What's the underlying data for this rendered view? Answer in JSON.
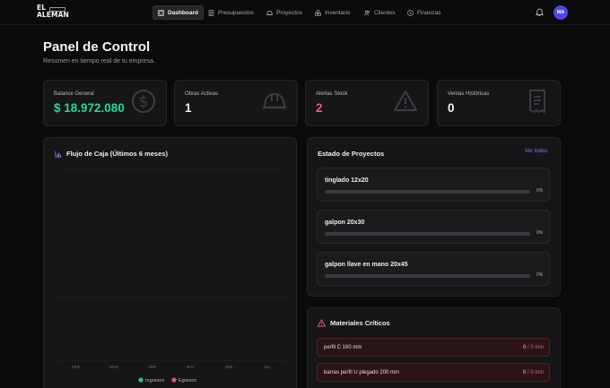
{
  "brand": {
    "line1": "EL",
    "line2": "ALEMAN"
  },
  "nav": {
    "items": [
      {
        "label": "Dashboard",
        "icon": "dashboard-icon",
        "active": true
      },
      {
        "label": "Presupuestos",
        "icon": "document-icon",
        "active": false
      },
      {
        "label": "Proyectos",
        "icon": "helmet-icon",
        "active": false
      },
      {
        "label": "Inventario",
        "icon": "boxes-icon",
        "active": false
      },
      {
        "label": "Clientes",
        "icon": "users-icon",
        "active": false
      },
      {
        "label": "Finanzas",
        "icon": "coin-icon",
        "active": false
      }
    ],
    "avatar": "MA"
  },
  "header": {
    "title": "Panel de Control",
    "subtitle": "Resumen en tiempo real de tu empresa."
  },
  "stats": [
    {
      "label": "Balance General",
      "value": "$ 18.972.080",
      "color": "#2fd19a",
      "icon": "dollar-icon"
    },
    {
      "label": "Obras Activas",
      "value": "1",
      "color": "#f3f3f4",
      "icon": "helmet-icon"
    },
    {
      "label": "Alertas Stock",
      "value": "2",
      "color": "#f25c6c",
      "icon": "warning-icon"
    },
    {
      "label": "Ventas Históricas",
      "value": "0",
      "color": "#f3f3f4",
      "icon": "receipt-icon"
    }
  ],
  "cashflow": {
    "title": "Flujo de Caja (Últimos 6 meses)",
    "chart_data": {
      "type": "bar",
      "categories": [
        "FEB",
        "MAR",
        "ABR",
        "MAY",
        "JUN",
        "JUL"
      ],
      "series": [
        {
          "name": "Ingresos",
          "color": "#22c58b",
          "values": [
            0,
            0,
            0,
            0,
            0,
            0
          ]
        },
        {
          "name": "Egresos",
          "color": "#f0506a",
          "values": [
            0,
            0,
            0,
            0,
            0,
            0
          ]
        }
      ],
      "legend": "bottom-center",
      "grid": true
    }
  },
  "projects": {
    "title": "Estado de Proyectos",
    "link": "Ver todos",
    "items": [
      {
        "name": "tinglado 12x20",
        "progress": 0,
        "label": "0%"
      },
      {
        "name": "galpon 20x30",
        "progress": 0,
        "label": "0%"
      },
      {
        "name": "galpon llave en mano 20x45",
        "progress": 0,
        "label": "0%"
      }
    ]
  },
  "materials": {
    "title": "Materiales Críticos",
    "items": [
      {
        "name": "perfil C 160 mm",
        "current": "0",
        "rest": " / 0 min"
      },
      {
        "name": "barras perfil U plegado 200 mm",
        "current": "0",
        "rest": " / 0 min"
      }
    ]
  }
}
